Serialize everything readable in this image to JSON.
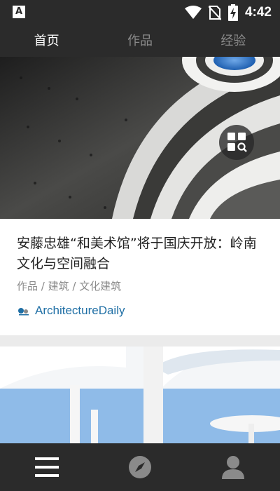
{
  "status_bar": {
    "time": "4:42",
    "app_icon": "A"
  },
  "tabs": [
    {
      "label": "首页",
      "active": true
    },
    {
      "label": "作品",
      "active": false
    },
    {
      "label": "经验",
      "active": false
    }
  ],
  "feed": {
    "cards": [
      {
        "title": "安藤忠雄“和美术馆”将于国庆开放：岭南文化与空间融合",
        "meta": "作品 / 建筑 / 文化建筑",
        "source": "ArchitectureDaily"
      }
    ]
  },
  "icons": {
    "status": [
      "wifi-icon",
      "no-sim-icon",
      "battery-charging-icon"
    ],
    "overlay": "grid-search-icon",
    "bottom_nav": [
      "menu-icon",
      "compass-icon",
      "user-icon"
    ]
  },
  "colors": {
    "bar_bg": "#2b2b2b",
    "source_link": "#1f6fa5",
    "tab_active": "#ffffff",
    "tab_inactive": "#8a8a8a"
  }
}
